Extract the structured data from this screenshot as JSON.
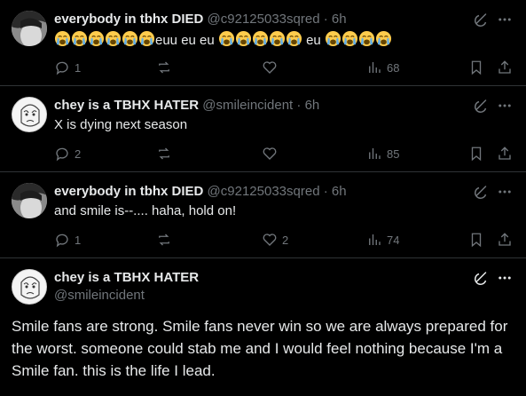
{
  "colors": {
    "background": "#000000",
    "text": "#e7e9ea",
    "muted": "#71767b",
    "divider": "#2f3336"
  },
  "tweets": [
    {
      "name": "everybody in tbhx DIED",
      "handle": "@c92125033sqred",
      "dot": "·",
      "time": "6h",
      "text_parts": [
        "euu eu eu",
        "eu"
      ],
      "emoji_groups": [
        6,
        5,
        4
      ],
      "emoji_icon": "loudly-crying-face-icon",
      "replies": "1",
      "reposts": "",
      "likes": "",
      "views": "68"
    },
    {
      "name": "chey is a TBHX HATER",
      "handle": "@smileincident",
      "dot": "·",
      "time": "6h",
      "text": "X is dying next season",
      "replies": "2",
      "reposts": "",
      "likes": "",
      "views": "85"
    },
    {
      "name": "everybody in tbhx DIED",
      "handle": "@c92125033sqred",
      "dot": "·",
      "time": "6h",
      "text": "and smile is--.... haha, hold on!",
      "replies": "1",
      "reposts": "",
      "likes": "2",
      "views": "74"
    }
  ],
  "main_tweet": {
    "name": "chey is a TBHX HATER",
    "handle": "@smileincident",
    "text": "Smile fans are strong. Smile fans never win so we are always prepared for the worst. someone could stab me and I would feel nothing because I'm a Smile fan. this is the life I lead."
  }
}
